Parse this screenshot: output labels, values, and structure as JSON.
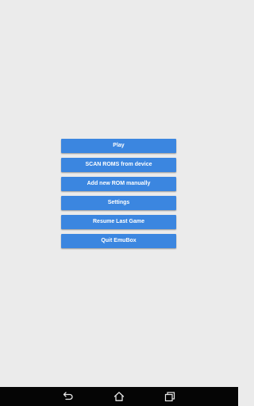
{
  "menu": {
    "items": [
      {
        "label": "Play"
      },
      {
        "label": "SCAN ROMS from device"
      },
      {
        "label": "Add new ROM manually"
      },
      {
        "label": "Settings"
      },
      {
        "label": "Resume Last Game"
      },
      {
        "label": "Quit EmuBox"
      }
    ]
  },
  "navbar": {
    "icons": [
      "back-icon",
      "home-icon",
      "recent-apps-icon"
    ]
  },
  "colors": {
    "background": "#ebebeb",
    "button": "#3b86e0",
    "button_text": "#ffffff",
    "navbar": "#050505"
  }
}
